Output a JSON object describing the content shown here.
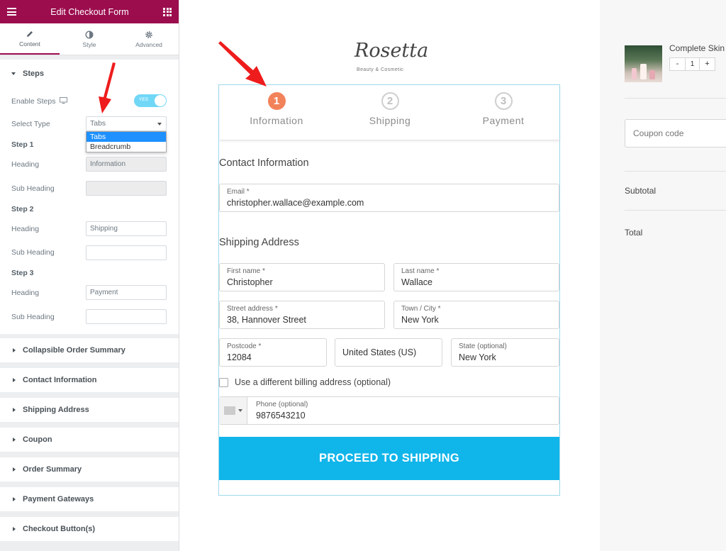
{
  "panel": {
    "title": "Edit Checkout Form",
    "tabs": [
      {
        "label": "Content",
        "icon": "pencil-icon"
      },
      {
        "label": "Style",
        "icon": "half-circle-icon"
      },
      {
        "label": "Advanced",
        "icon": "gear-icon"
      }
    ],
    "steps_section": {
      "title": "Steps",
      "enable_steps_label": "Enable Steps",
      "toggle_text": "YES",
      "select_type_label": "Select Type",
      "select_type_value": "Tabs",
      "select_options": [
        "Tabs",
        "Breadcrumb"
      ],
      "step1": {
        "title": "Step 1",
        "heading_label": "Heading",
        "heading_value": "Information",
        "subheading_label": "Sub Heading",
        "subheading_value": ""
      },
      "step2": {
        "title": "Step 2",
        "heading_label": "Heading",
        "heading_value": "Shipping",
        "subheading_label": "Sub Heading",
        "subheading_value": ""
      },
      "step3": {
        "title": "Step 3",
        "heading_label": "Heading",
        "heading_value": "Payment",
        "subheading_label": "Sub Heading",
        "subheading_value": ""
      }
    },
    "collapsed_sections": [
      "Collapsible Order Summary",
      "Contact Information",
      "Shipping Address",
      "Coupon",
      "Order Summary",
      "Payment Gateways",
      "Checkout Button(s)"
    ]
  },
  "preview": {
    "logo": "Rosetta",
    "logo_sub": "Beauty & Cosmetic",
    "steps": [
      {
        "number": "1",
        "label": "Information"
      },
      {
        "number": "2",
        "label": "Shipping"
      },
      {
        "number": "3",
        "label": "Payment"
      }
    ],
    "contact_heading": "Contact Information",
    "email_label": "Email *",
    "email_value": "christopher.wallace@example.com",
    "shipping_heading": "Shipping Address",
    "first_name_label": "First name *",
    "first_name_value": "Christopher",
    "last_name_label": "Last name *",
    "last_name_value": "Wallace",
    "street_label": "Street address *",
    "street_value": "38, Hannover Street",
    "city_label": "Town / City *",
    "city_value": "New York",
    "postcode_label": "Postcode *",
    "postcode_value": "12084",
    "country_value": "United States (US)",
    "state_label": "State (optional)",
    "state_value": "New York",
    "billing_checkbox_label": "Use a different billing address (optional)",
    "phone_label": "Phone (optional)",
    "phone_value": "9876543210",
    "proceed_button": "PROCEED TO SHIPPING"
  },
  "summary": {
    "product_name": "Complete Skin",
    "qty_minus": "-",
    "qty_value": "1",
    "qty_plus": "+",
    "coupon_placeholder": "Coupon code",
    "subtotal_label": "Subtotal",
    "total_label": "Total"
  },
  "colors": {
    "header": "#9c0d4e",
    "active_step": "#f2825a",
    "button": "#10b5ea",
    "toggle": "#71d7f7",
    "arrow": "#ee1c1c"
  }
}
